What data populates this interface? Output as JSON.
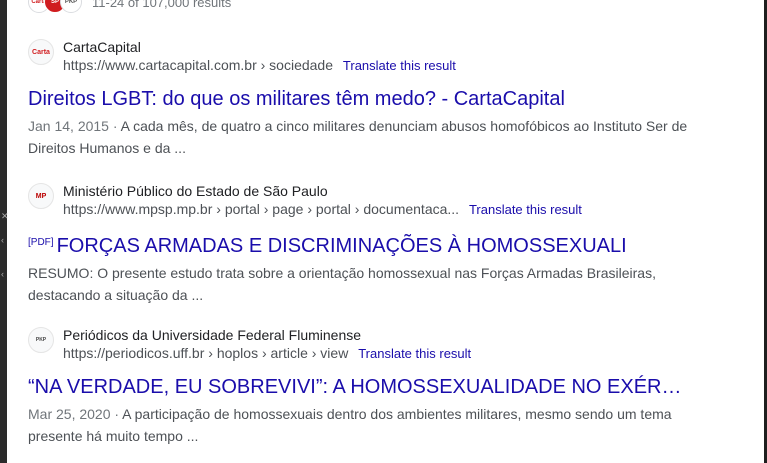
{
  "top": {
    "avatars": [
      "Carta",
      "SP",
      "PKP"
    ],
    "results_count": "11-24 of 107,000 results"
  },
  "results": [
    {
      "favicon_text": "Carta",
      "source": "CartaCapital",
      "url": "https://www.cartacapital.com.br › sociedade",
      "translate": "Translate this result",
      "pdf": "",
      "title": "Direitos LGBT: do que os militares têm medo? - CartaCapital",
      "date": "Jan 14, 2015 · ",
      "snippet": "A cada mês, de quatro a cinco militares denunciam abusos homofóbicos ao Instituto Ser de Direitos Humanos e da ..."
    },
    {
      "favicon_text": "MP",
      "source": "Ministério Público do Estado de São Paulo",
      "url": "https://www.mpsp.mp.br › portal › page › portal › documentaca...",
      "translate": "Translate this result",
      "pdf": "[PDF]",
      "title": "FORÇAS ARMADAS E DISCRIMINAÇÕES À HOMOSSEXUALI",
      "date": "",
      "snippet": "RESUMO: O presente estudo trata sobre a orientação homossexual nas Forças Armadas Brasileiras, destacando a situação da ..."
    },
    {
      "favicon_text": "PKP",
      "source": "Periódicos da Universidade Federal Fluminense",
      "url": "https://periodicos.uff.br › hoplos › article › view",
      "translate": "Translate this result",
      "pdf": "",
      "title": "“NA VERDADE, EU SOBREVIVI”: A HOMOSSEXUALIDADE NO EXÉRCITO ...",
      "date": "Mar 25, 2020 · ",
      "snippet": "A participação de homossexuais dentro dos ambientes militares, mesmo sendo um tema presente há muito tempo ..."
    }
  ]
}
